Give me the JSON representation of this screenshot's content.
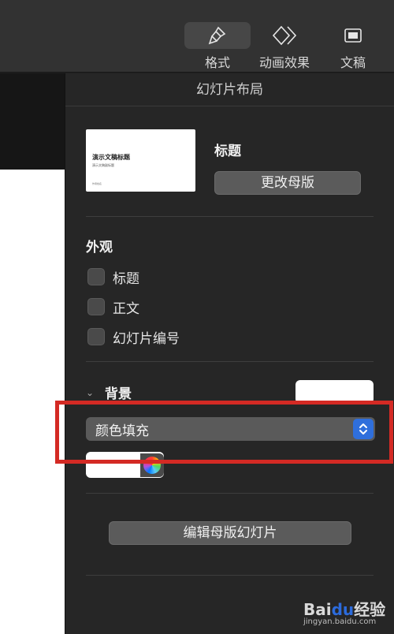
{
  "toolbar": {
    "format_label": "格式",
    "animation_label": "动画效果",
    "document_label": "文稿",
    "format_icon": "paintbrush-icon",
    "animation_icon": "diamond-icon",
    "document_icon": "document-icon"
  },
  "inspector": {
    "title": "幻灯片布局",
    "thumbnail": {
      "title": "演示文稿标题",
      "subtitle": "演示文稿副标题",
      "footer": "作者姓名"
    },
    "layout_name": "标题",
    "change_master_label": "更改母版",
    "appearance": {
      "heading": "外观",
      "options": [
        {
          "label": "标题",
          "checked": false
        },
        {
          "label": "正文",
          "checked": false
        },
        {
          "label": "幻灯片编号",
          "checked": false
        }
      ]
    },
    "background": {
      "heading": "背景",
      "swatch_color": "#ffffff",
      "fill_type": "颜色填充",
      "fill_color": "#ffffff"
    },
    "edit_master_label": "编辑母版幻灯片"
  },
  "colors": {
    "highlight": "#d42a24",
    "stepper_accent": "#2f6fdc"
  },
  "watermark": {
    "logo_text": "Bai",
    "logo_mid": "du",
    "logo_suffix": "经验",
    "url": "jingyan.baidu.com"
  }
}
